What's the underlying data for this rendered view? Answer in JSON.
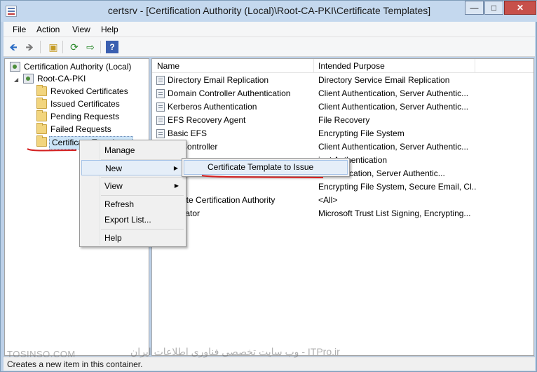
{
  "window": {
    "title": "certsrv - [Certification Authority (Local)\\Root-CA-PKI\\Certificate Templates]",
    "min_glyph": "—",
    "max_glyph": "□",
    "close_glyph": "✕"
  },
  "menu": {
    "items": [
      "File",
      "Action",
      "View",
      "Help"
    ]
  },
  "toolbar": {
    "icons": [
      "back-arrow-icon",
      "forward-arrow-icon",
      "up-folder-icon",
      "refresh-icon",
      "export-list-icon",
      "help-icon"
    ],
    "back": "🡸",
    "forward": "🡺",
    "up": "▣",
    "refresh": "⟳",
    "export": "⇨",
    "help": "?"
  },
  "tree": {
    "root": "Certification Authority (Local)",
    "ca": "Root-CA-PKI",
    "expander": "◢",
    "folders": [
      "Revoked Certificates",
      "Issued Certificates",
      "Pending Requests",
      "Failed Requests",
      "Certificate Templates"
    ]
  },
  "list": {
    "columns": [
      "Name",
      "Intended Purpose"
    ],
    "rows": [
      {
        "name": "Directory Email Replication",
        "purpose": "Directory Service Email Replication"
      },
      {
        "name": "Domain Controller Authentication",
        "purpose": "Client Authentication, Server Authentic..."
      },
      {
        "name": "Kerberos Authentication",
        "purpose": "Client Authentication, Server Authentic..."
      },
      {
        "name": "EFS Recovery Agent",
        "purpose": "File Recovery"
      },
      {
        "name": "Basic EFS",
        "purpose": "Encrypting File System"
      },
      {
        "name": "ain Controller",
        "purpose": "Client Authentication, Server Authentic..."
      },
      {
        "name": "",
        "purpose": "ient Authentication"
      },
      {
        "name": "",
        "purpose": "Authentication, Server Authentic..."
      },
      {
        "name": "",
        "purpose": "Encrypting File System, Secure Email, Cl..."
      },
      {
        "name": "rdinate Certification Authority",
        "purpose": "<All>"
      },
      {
        "name": "inistrator",
        "purpose": "Microsoft Trust List Signing, Encrypting..."
      }
    ]
  },
  "context_menu": {
    "items": [
      "Manage",
      "New",
      "View",
      "Refresh",
      "Export List...",
      "Help"
    ],
    "submenu_arrow": "▶",
    "submenu": [
      "Certificate Template to Issue"
    ]
  },
  "status": {
    "text": "Creates a new item in this container."
  },
  "watermark": {
    "left": "TOSINSO.COM",
    "right": "وب سایت تخصصی فناوری اطلاعات ایران - ITPro.ir"
  },
  "colors": {
    "titlebar": "#c4d8ee",
    "selection": "#cce4f7",
    "close_button": "#c7504a",
    "annotation": "#d42020"
  }
}
